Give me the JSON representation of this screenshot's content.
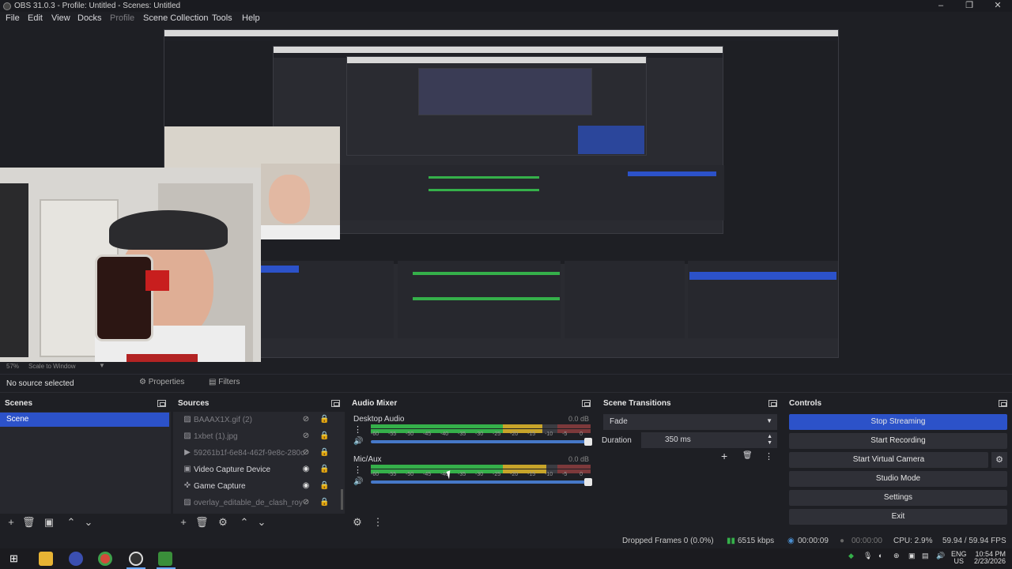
{
  "window": {
    "title": "OBS 31.0.3 - Profile: Untitled - Scenes: Untitled",
    "minimize": "–",
    "maximize": "❐",
    "close": "✕"
  },
  "menu": [
    "File",
    "Edit",
    "View",
    "Docks",
    "Profile",
    "Scene Collection",
    "Tools",
    "Help"
  ],
  "preview": {
    "zoom": "57%",
    "scale_label": "Scale to Window"
  },
  "context": {
    "no_source": "No source selected",
    "properties": "Properties",
    "filters": "Filters"
  },
  "scenes": {
    "title": "Scenes",
    "items": [
      "Scene"
    ]
  },
  "sources": {
    "title": "Sources",
    "items": [
      {
        "label": "BAAAX1X.gif (2)",
        "icon": "image-icon",
        "visible": false
      },
      {
        "label": "1xbet (1).jpg",
        "icon": "image-icon",
        "visible": false
      },
      {
        "label": "59261b1f-6e84-462f-9e8c-280c",
        "icon": "media-play-icon",
        "visible": false
      },
      {
        "label": "Video Capture Device",
        "icon": "camera-icon",
        "visible": true
      },
      {
        "label": "Game Capture",
        "icon": "gamepad-icon",
        "visible": true
      },
      {
        "label": "overlay_editable_de_clash_roy",
        "icon": "image-icon",
        "visible": false
      }
    ]
  },
  "mixer": {
    "title": "Audio Mixer",
    "tracks": [
      {
        "name": "Desktop Audio",
        "db": "0.0 dB",
        "level": 0.78
      },
      {
        "name": "Mic/Aux",
        "db": "0.0 dB",
        "level": 0.8
      }
    ],
    "scale": [
      "-60",
      "-55",
      "-50",
      "-45",
      "-40",
      "-35",
      "-30",
      "-25",
      "-20",
      "-15",
      "-10",
      "-5",
      "0"
    ]
  },
  "transitions": {
    "title": "Scene Transitions",
    "selected": "Fade",
    "duration_label": "Duration",
    "duration": "350 ms"
  },
  "controls": {
    "title": "Controls",
    "buttons": [
      "Stop Streaming",
      "Start Recording",
      "Start Virtual Camera",
      "Studio Mode",
      "Settings",
      "Exit"
    ]
  },
  "status": {
    "dropped": "Dropped Frames 0 (0.0%)",
    "bitrate": "6515 kbps",
    "stream_time": "00:00:09",
    "rec_time": "00:00:00",
    "cpu": "CPU: 2.9%",
    "fps": "59.94 / 59.94 FPS"
  },
  "taskbar": {
    "lang_top": "ENG",
    "lang_bottom": "US",
    "time": "10:54 PM",
    "date": "2/23/2026"
  },
  "colors": {
    "accent": "#2c52c9",
    "bg": "#1e1f24",
    "panel": "#27282e"
  }
}
